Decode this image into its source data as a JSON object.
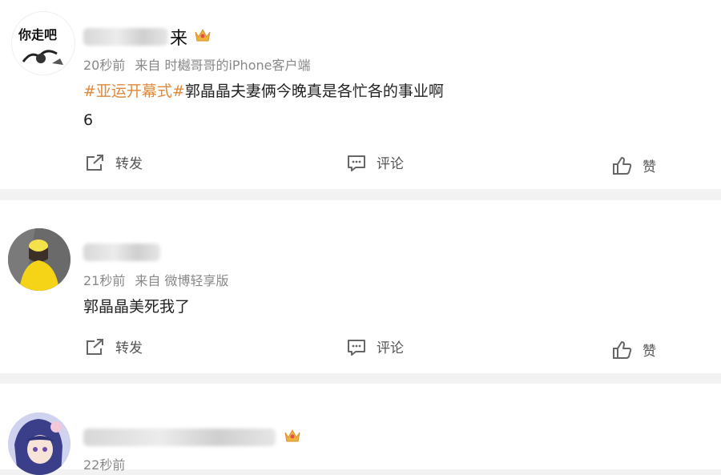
{
  "posts": [
    {
      "name_tail": "来",
      "avatar_icon": "cartoon-text-avatar",
      "crown_icon": "vip-crown-icon",
      "time": "20秒前",
      "source": "来自 时樾哥哥的iPhone客户端",
      "topic": "#亚运开幕式#",
      "text": "郭晶晶夫妻俩今晚真是各忙各的事业啊",
      "extra": "6",
      "actions": {
        "repost": "转发",
        "comment": "评论",
        "like": "赞"
      }
    },
    {
      "name_tail": "",
      "avatar_icon": "yellow-figure-avatar",
      "time": "21秒前",
      "source": "来自 微博轻享版",
      "text": "郭晶晶美死我了",
      "actions": {
        "repost": "转发",
        "comment": "评论",
        "like": "赞"
      }
    },
    {
      "name_tail": "",
      "avatar_icon": "anime-girl-avatar",
      "crown_icon": "vip-crown-icon",
      "time": "22秒前"
    }
  ],
  "colors": {
    "topic": "#e0893a",
    "meta": "#888888",
    "separator": "#f2f2f2"
  }
}
